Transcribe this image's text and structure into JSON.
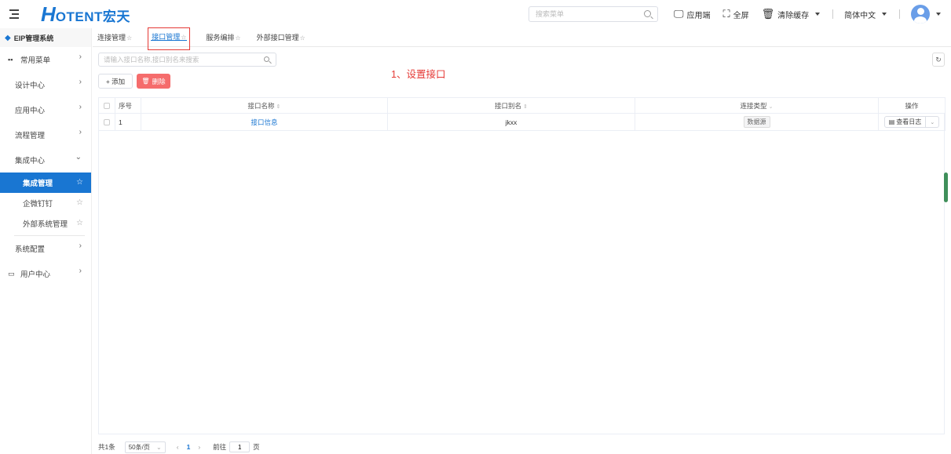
{
  "header": {
    "logo_letter": "H",
    "logo_text": "OTENT宏天",
    "search_placeholder": "搜索菜单",
    "actions": {
      "app_end": "应用端",
      "fullscreen": "全屏",
      "clear_cache": "清除缓存",
      "language": "简体中文"
    }
  },
  "sidebar": {
    "system_title": "EIP管理系统",
    "common_menu": "常用菜单",
    "items": [
      {
        "label": "设计中心"
      },
      {
        "label": "应用中心"
      },
      {
        "label": "流程管理"
      },
      {
        "label": "集成中心"
      }
    ],
    "sub_items": [
      {
        "label": "集成管理"
      },
      {
        "label": "企微钉钉"
      },
      {
        "label": "外部系统管理"
      }
    ],
    "system_config": "系统配置",
    "user_center": "用户中心"
  },
  "tabs": [
    {
      "label": "连接管理"
    },
    {
      "label": "接口管理"
    },
    {
      "label": "服务编排"
    },
    {
      "label": "外部接口管理"
    }
  ],
  "toolbar": {
    "search_placeholder": "请输入接口名称,接口别名来搜索",
    "add_label": "+ 添加",
    "delete_label": "删除"
  },
  "annotation": "1、设置接口",
  "table": {
    "columns": {
      "index": "序号",
      "name": "接口名称",
      "alias": "接口别名",
      "type": "连接类型",
      "ops": "操作"
    },
    "rows": [
      {
        "index": "1",
        "name": "接口信息",
        "alias": "jkxx",
        "type": "数据源",
        "op": "查看日志"
      }
    ]
  },
  "pagination": {
    "total": "共1条",
    "page_size": "50条/页",
    "current_page": "1",
    "goto_label": "前往",
    "goto_value": "1",
    "page_suffix": "页"
  },
  "colors": {
    "primary": "#1976d2",
    "danger": "#f56c6c",
    "annotation": "#e53935"
  }
}
